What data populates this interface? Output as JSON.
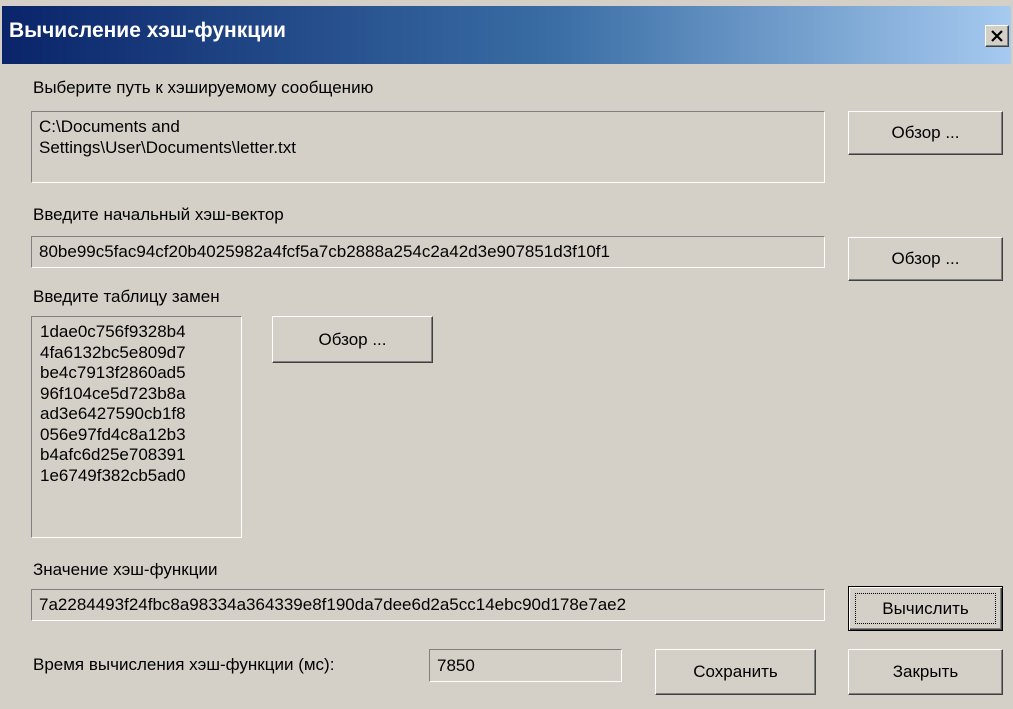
{
  "window": {
    "title": "Вычисление хэш-функции"
  },
  "message_path": {
    "label": "Выберите путь к хэшируемому сообщению",
    "value": "C:\\Documents and\nSettings\\User\\Documents\\letter.txt",
    "browse_label": "Обзор ..."
  },
  "init_vector": {
    "label": "Введите начальный хэш-вектор",
    "value": "80be99c5fac94cf20b4025982a4fcf5a7cb2888a254c2a42d3e907851d3f10f1",
    "browse_label": "Обзор ..."
  },
  "subst_table": {
    "label": "Введите таблицу замен",
    "rows": [
      "1dae0c756f9328b4",
      "4fa6132bc5e809d7",
      "be4c7913f2860ad5",
      "96f104ce5d723b8a",
      "ad3e6427590cb1f8",
      "056e97fd4c8a12b3",
      "b4afc6d25e708391",
      "1e6749f382cb5ad0"
    ],
    "browse_label": "Обзор ..."
  },
  "hash_value": {
    "label": "Значение хэш-функции",
    "value": "7a2284493f24fbc8a98334a364339e8f190da7dee6d2a5cc14ebc90d178e7ae2",
    "compute_label": "Вычислить"
  },
  "timing": {
    "label": "Время вычисления хэш-функции (мс):",
    "value": "7850",
    "save_label": "Сохранить",
    "close_label": "Закрыть"
  },
  "icons": {
    "close": "close-icon"
  }
}
